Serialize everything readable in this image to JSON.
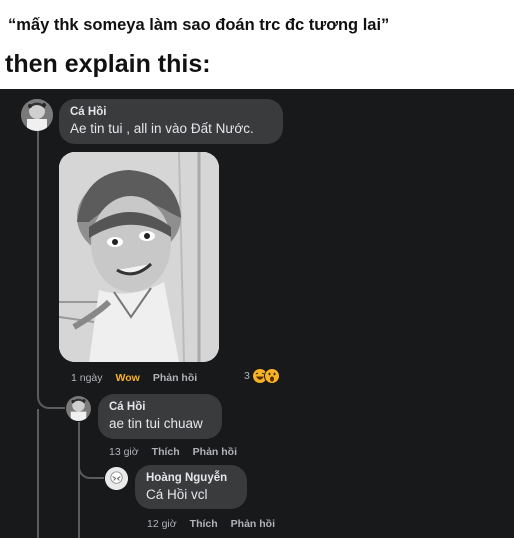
{
  "meme": {
    "caption_top": "“mấy thk someya làm sao đoán trc đc tương lai”",
    "caption_bottom": "then explain this:"
  },
  "comments": [
    {
      "author": "Cá Hồi",
      "text": "Ae tin tui , all in vào Đất Nước.",
      "time": "1 ngày",
      "reaction_selected": "Wow",
      "reply_label": "Phản hồi",
      "reaction_count": "3",
      "reaction_icons": [
        "haha-icon",
        "wow-icon"
      ]
    },
    {
      "author": "Cá Hồi",
      "text": "ae tin tui chuaw",
      "time": "13 giờ",
      "like_label": "Thích",
      "reply_label": "Phản hồi"
    },
    {
      "author": "Hoàng Nguyễn",
      "text": "Cá Hồi vcl",
      "time": "12 giờ",
      "like_label": "Thích",
      "reply_label": "Phản hồi"
    }
  ],
  "colors": {
    "panel_bg": "#18191a",
    "bubble_bg": "#3a3b3c",
    "text_primary": "#e4e6eb",
    "text_secondary": "#b0b3b8",
    "wow_accent": "#f7b125"
  }
}
